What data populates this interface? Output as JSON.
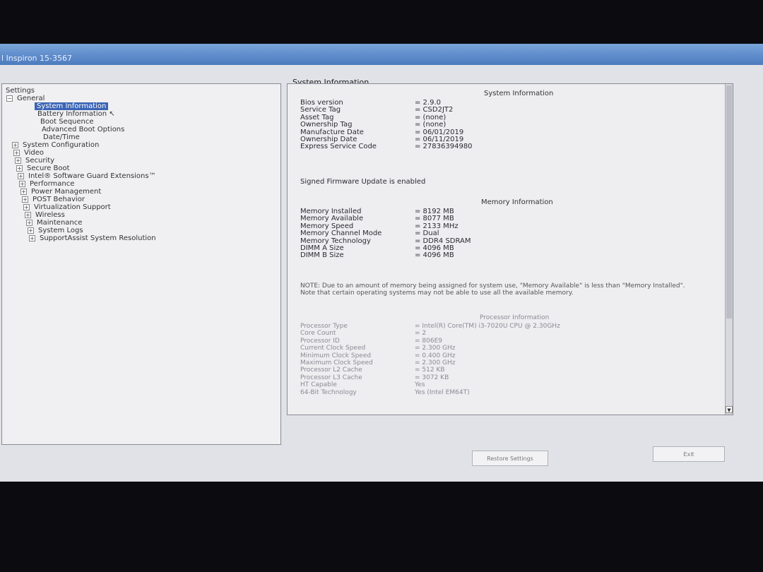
{
  "window": {
    "title": "l Inspiron 15-3567"
  },
  "tree": {
    "root": "Settings",
    "items": [
      {
        "label": "General",
        "box": "−"
      },
      {
        "label": "System Information",
        "selected": true
      },
      {
        "label": "Battery Information"
      },
      {
        "label": "Boot Sequence"
      },
      {
        "label": "Advanced Boot Options"
      },
      {
        "label": "Date/Time"
      },
      {
        "label": "System Configuration",
        "box": "+"
      },
      {
        "label": "Video",
        "box": "+"
      },
      {
        "label": "Security",
        "box": "+"
      },
      {
        "label": "Secure Boot",
        "box": "+"
      },
      {
        "label": "Intel® Software Guard Extensions™",
        "box": "+"
      },
      {
        "label": "Performance",
        "box": "+"
      },
      {
        "label": "Power Management",
        "box": "+"
      },
      {
        "label": "POST Behavior",
        "box": "+"
      },
      {
        "label": "Virtualization Support",
        "box": "+"
      },
      {
        "label": "Wireless",
        "box": "+"
      },
      {
        "label": "Maintenance",
        "box": "+"
      },
      {
        "label": "System Logs",
        "box": "+"
      },
      {
        "label": "SupportAssist System Resolution",
        "box": "+"
      }
    ]
  },
  "panel": {
    "title": "System Information",
    "system": {
      "header": "System Information",
      "rows": [
        {
          "k": "Bios version",
          "v": "= 2.9.0"
        },
        {
          "k": "Service Tag",
          "v": "= CSD2JT2"
        },
        {
          "k": "Asset Tag",
          "v": "= (none)"
        },
        {
          "k": "Ownership Tag",
          "v": "= (none)"
        },
        {
          "k": "Manufacture Date",
          "v": "= 06/01/2019"
        },
        {
          "k": "Ownership Date",
          "v": "= 06/11/2019"
        },
        {
          "k": "Express Service Code",
          "v": "= 27836394980"
        }
      ],
      "signed": "Signed Firmware Update is enabled"
    },
    "memory": {
      "header": "Memory Information",
      "rows": [
        {
          "k": "Memory Installed",
          "v": "= 8192 MB"
        },
        {
          "k": "Memory Available",
          "v": "= 8077 MB"
        },
        {
          "k": "Memory Speed",
          "v": "= 2133 MHz"
        },
        {
          "k": "Memory Channel Mode",
          "v": "= Dual"
        },
        {
          "k": "Memory Technology",
          "v": "= DDR4 SDRAM"
        },
        {
          "k": "DIMM A Size",
          "v": "= 4096 MB"
        },
        {
          "k": "DIMM B Size",
          "v": "= 4096 MB"
        }
      ],
      "note": "NOTE: Due to an amount of memory being assigned for system use, \"Memory Available\" is less than \"Memory Installed\". Note that certain operating systems may not be able to use all the available memory."
    },
    "processor": {
      "header": "Processor Information",
      "rows": [
        {
          "k": "Processor Type",
          "v": "= Intel(R) Core(TM) i3-7020U CPU @ 2.30GHz"
        },
        {
          "k": "Core Count",
          "v": "= 2"
        },
        {
          "k": "Processor ID",
          "v": "= 806E9"
        },
        {
          "k": "Current Clock Speed",
          "v": "= 2.300 GHz"
        },
        {
          "k": "Minimum Clock Speed",
          "v": "= 0.400 GHz"
        },
        {
          "k": "Maximum Clock Speed",
          "v": "= 2.300 GHz"
        },
        {
          "k": "Processor L2 Cache",
          "v": "= 512 KB"
        },
        {
          "k": "Processor L3 Cache",
          "v": "= 3072 KB"
        },
        {
          "k": "HT Capable",
          "v": "Yes"
        },
        {
          "k": "64-Bit Technology",
          "v": "Yes (Intel EM64T)"
        }
      ]
    }
  },
  "buttons": {
    "restore": "Restore Settings",
    "exit": "Exit"
  }
}
